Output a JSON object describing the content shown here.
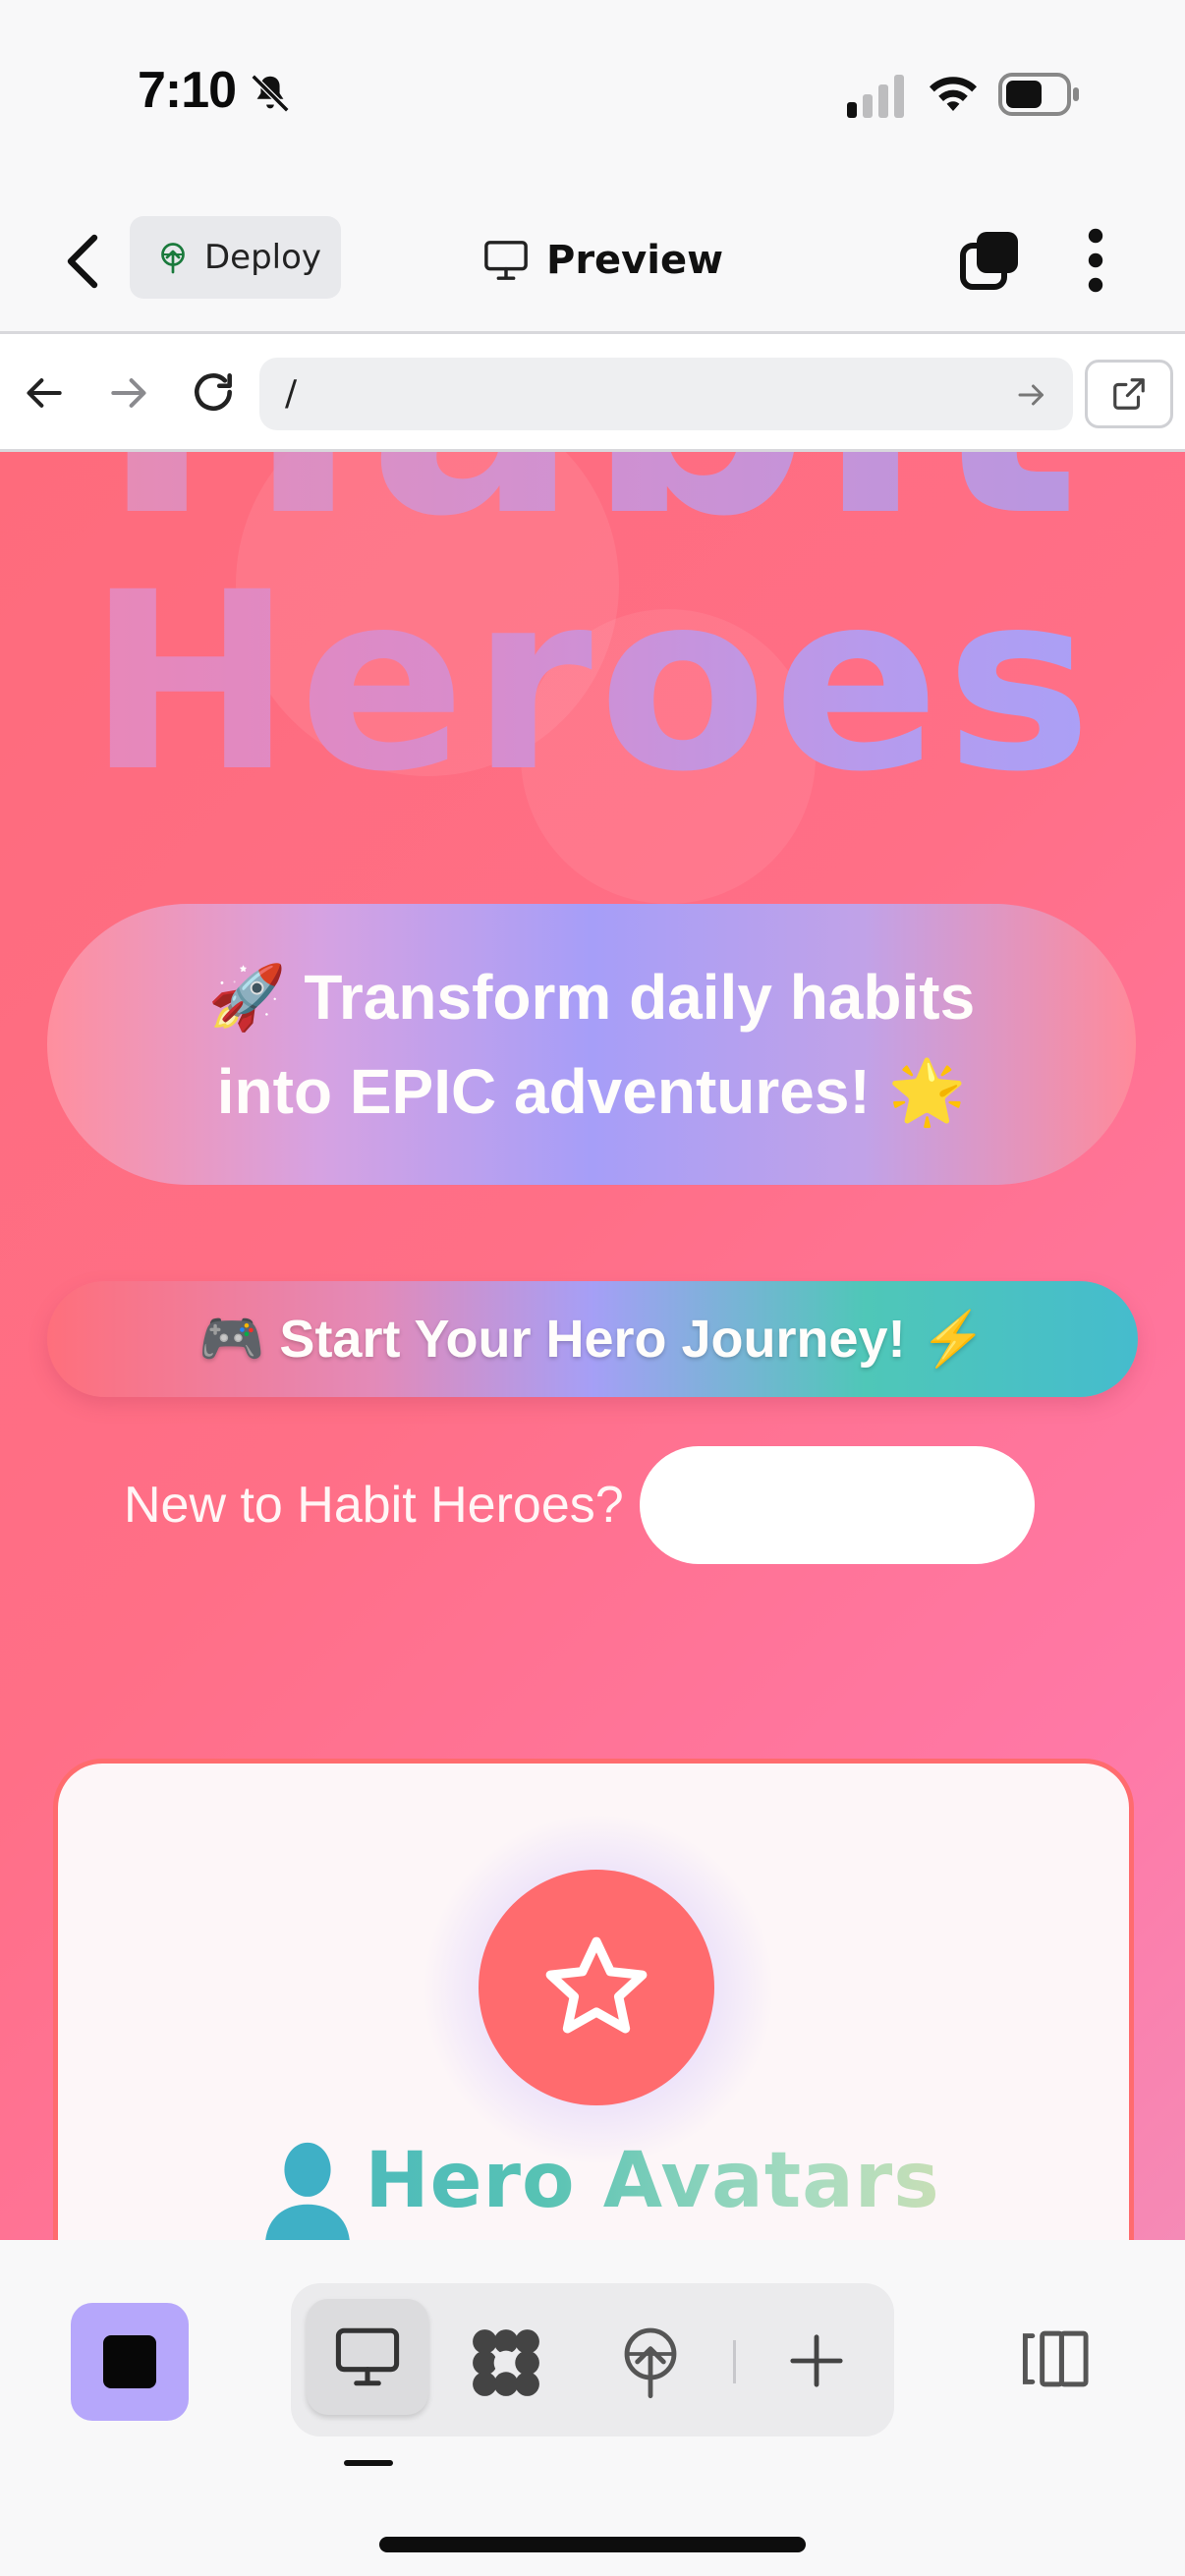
{
  "status_bar": {
    "time": "7:10",
    "icons": [
      "bell-slash-icon",
      "signal-icon",
      "wifi-icon",
      "battery-icon"
    ]
  },
  "header": {
    "deploy_label": "Deploy",
    "title": "Preview",
    "icons": [
      "chevron-left-icon",
      "deploy-icon",
      "desktop-icon",
      "tabs-icon",
      "kebab-icon"
    ]
  },
  "browser": {
    "url": "/",
    "icons": [
      "arrow-left-icon",
      "arrow-right-icon",
      "reload-icon",
      "go-arrow-icon",
      "external-link-icon"
    ]
  },
  "preview": {
    "title_partial": "Habit",
    "title": "Heroes",
    "tagline": "🚀 Transform daily habits into EPIC adventures! 🌟",
    "cta_label": "🎮 Start Your Hero Journey! ⚡",
    "signup_prompt": "New to Habit Heroes?",
    "signup_button_label": "",
    "feature_card": {
      "icon": "star-icon",
      "heading_icon": "person-icon",
      "heading": "Hero Avatars"
    },
    "colors": {
      "background": "#ff6f87",
      "accent_coral": "#ff6b6e",
      "accent_purple": "#a59ff6",
      "accent_teal": "#45bccd"
    }
  },
  "toolbar": {
    "icons": [
      "stop-square-icon",
      "desktop-icon",
      "grid-dots-icon",
      "deploy-icon",
      "plus-icon",
      "panel-toggle-icon"
    ],
    "active_tab": "desktop"
  }
}
